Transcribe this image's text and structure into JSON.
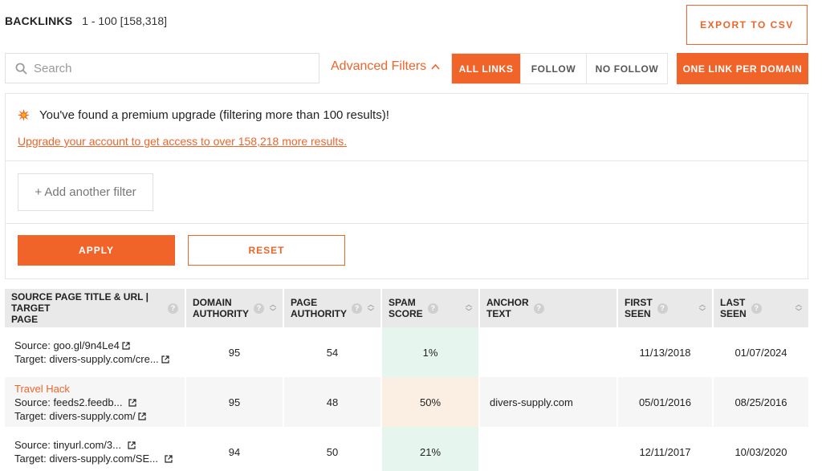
{
  "header": {
    "title": "BACKLINKS",
    "range": "1 - 100 [158,318]"
  },
  "export_label": "EXPORT TO CSV",
  "search": {
    "placeholder": "Search",
    "value": ""
  },
  "advanced_filters_label": "Advanced Filters",
  "filter_tabs": [
    {
      "label": "ALL LINKS",
      "active": true
    },
    {
      "label": "FOLLOW",
      "active": false
    },
    {
      "label": "NO FOLLOW",
      "active": false
    }
  ],
  "one_link_label": "ONE LINK PER DOMAIN",
  "upgrade": {
    "message": "You've found a premium upgrade (filtering more than 100 results)!",
    "link": "Upgrade your account to get access to over 158,218 more results."
  },
  "add_filter_label": "+ Add another filter",
  "apply_label": "APPLY",
  "reset_label": "RESET",
  "table": {
    "columns": [
      {
        "label1": "SOURCE PAGE TITLE & URL | TARGET",
        "label2": "PAGE"
      },
      {
        "label1": "DOMAIN",
        "label2": "AUTHORITY"
      },
      {
        "label1": "PAGE",
        "label2": "AUTHORITY"
      },
      {
        "label1": "SPAM",
        "label2": "SCORE"
      },
      {
        "label1": "ANCHOR",
        "label2": "TEXT"
      },
      {
        "label1": "FIRST",
        "label2": "SEEN"
      },
      {
        "label1": "LAST",
        "label2": "SEEN"
      }
    ],
    "source_label": "Source:",
    "target_label": "Target:",
    "rows": [
      {
        "title": "",
        "source": "goo.gl/9n4Le4",
        "target": "divers-supply.com/cre...",
        "domain_authority": "95",
        "page_authority": "54",
        "spam_score": "1%",
        "anchor": "",
        "first_seen": "11/13/2018",
        "last_seen": "01/07/2024"
      },
      {
        "title": "Travel Hack",
        "source": "feeds2.feedb...",
        "target": "divers-supply.com/",
        "domain_authority": "95",
        "page_authority": "48",
        "spam_score": "50%",
        "anchor": "divers-supply.com",
        "first_seen": "05/01/2016",
        "last_seen": "08/25/2016"
      },
      {
        "title": "",
        "source": "tinyurl.com/3...",
        "target": "divers-supply.com/SE...",
        "domain_authority": "94",
        "page_authority": "50",
        "spam_score": "21%",
        "anchor": "",
        "first_seen": "12/11/2017",
        "last_seen": "10/03/2020"
      }
    ]
  },
  "colors": {
    "accent": "#f0642a",
    "spam_low": "#e6f5ee",
    "spam_mid": "#fbeee2"
  }
}
